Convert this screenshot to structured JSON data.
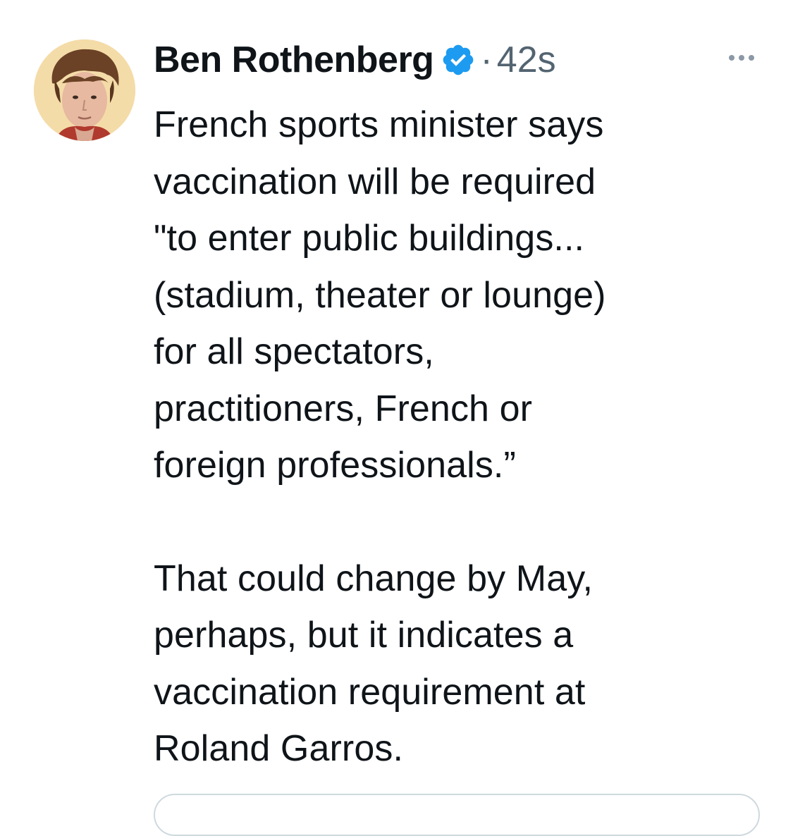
{
  "tweet": {
    "author_name": "Ben Rothenberg",
    "separator": "·",
    "timestamp": "42s",
    "paragraph1_lines": [
      "French sports minister says",
      "vaccination will be required",
      "\"to enter public buildings...",
      "(stadium, theater or lounge)",
      "for all spectators,",
      "practitioners, French or",
      "foreign professionals.”"
    ],
    "paragraph2_lines": [
      "That could change by May,",
      "perhaps, but it indicates a",
      "vaccination requirement at",
      "Roland Garros."
    ]
  },
  "icons": {
    "verified": "verified-badge-icon",
    "more": "more-options-icon"
  },
  "colors": {
    "text_primary": "#0f1419",
    "text_secondary": "#536471",
    "verified_blue": "#1d9bf0",
    "border": "#cfd9de"
  }
}
